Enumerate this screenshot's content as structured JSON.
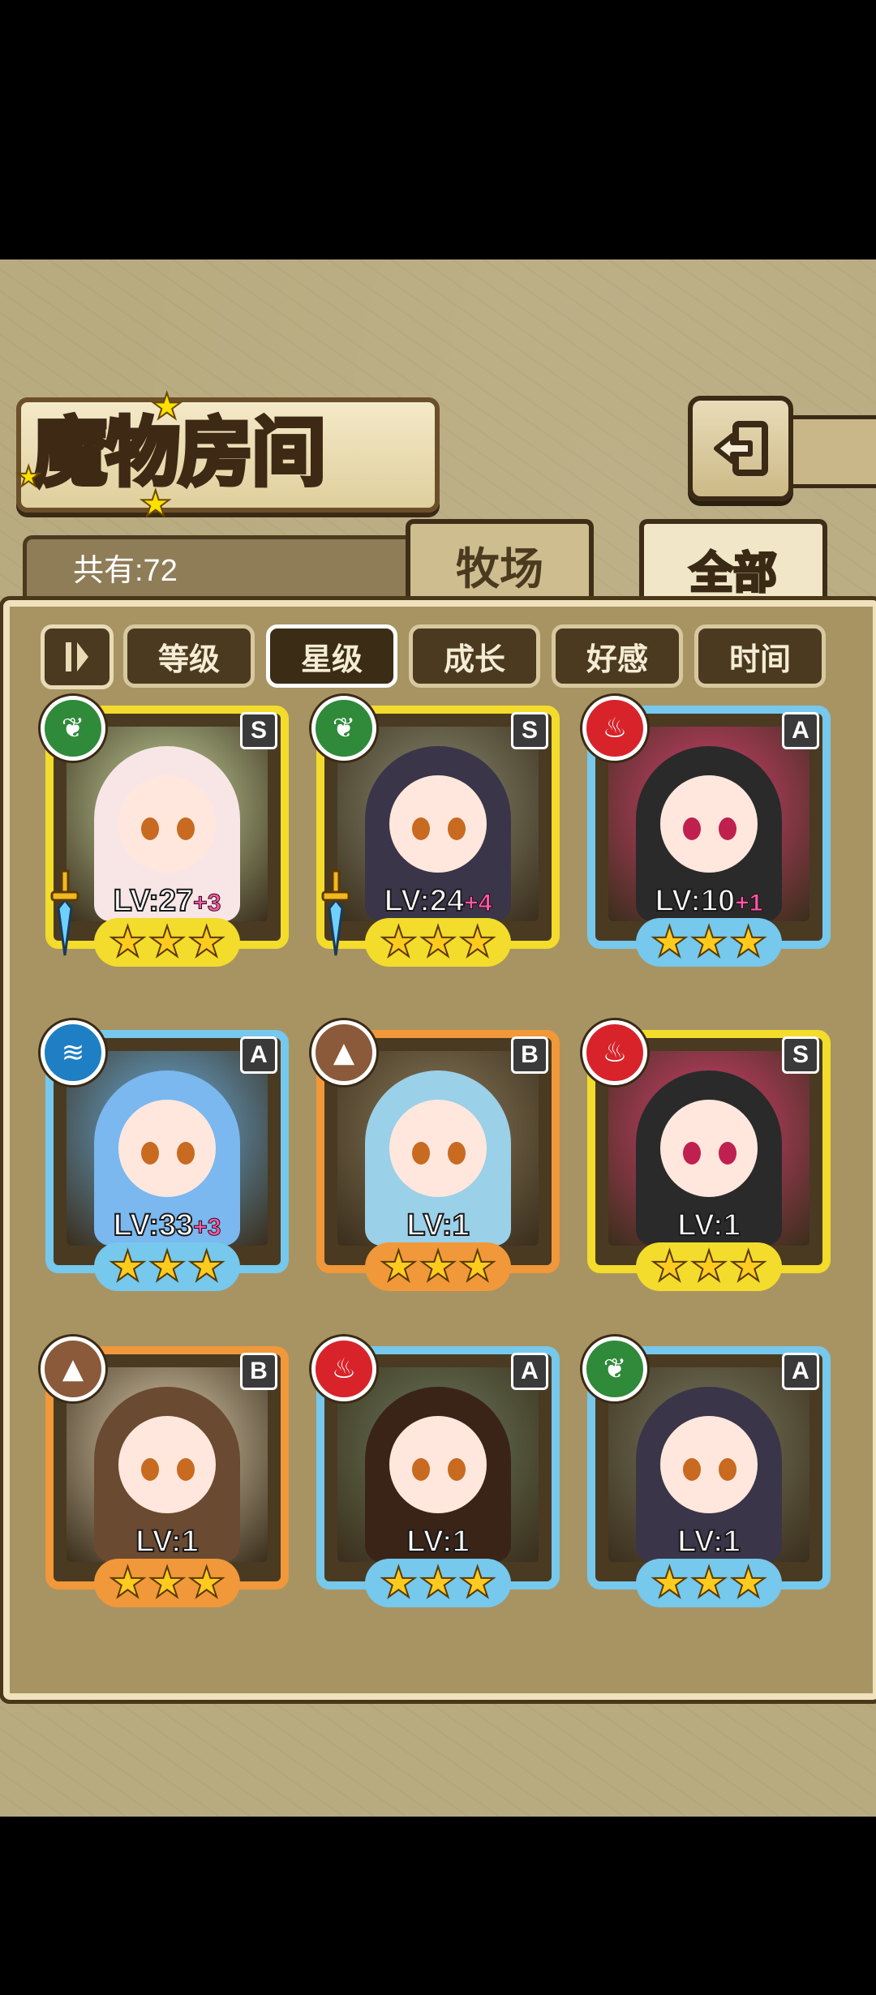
{
  "header": {
    "title": "魔物房间",
    "back_icon": "back-arrow-icon"
  },
  "summary": {
    "count_label": "共有:72"
  },
  "tabs": [
    {
      "label": "牧场",
      "active": false
    },
    {
      "label": "全部",
      "active": true
    }
  ],
  "sort": {
    "toggle_icon": "sort-order-icon",
    "options": [
      {
        "label": "等级",
        "selected": false
      },
      {
        "label": "星级",
        "selected": true
      },
      {
        "label": "成长",
        "selected": false
      },
      {
        "label": "好感",
        "selected": false
      },
      {
        "label": "时间",
        "selected": false
      }
    ]
  },
  "monsters": [
    {
      "element": "leaf-element-icon",
      "grade": "S",
      "level": "LV:27",
      "bonus": "+3",
      "stars": 3,
      "frame": "#f3dc2b",
      "equipped": true
    },
    {
      "element": "leaf-element-icon",
      "grade": "S",
      "level": "LV:24",
      "bonus": "+4",
      "stars": 3,
      "frame": "#f3dc2b",
      "equipped": true
    },
    {
      "element": "fire-element-icon",
      "grade": "A",
      "level": "LV:10",
      "bonus": "+1",
      "stars": 3,
      "frame": "#76c8ec",
      "equipped": false
    },
    {
      "element": "water-element-icon",
      "grade": "A",
      "level": "LV:33",
      "bonus": "+3",
      "stars": 3,
      "frame": "#76c8ec",
      "equipped": false
    },
    {
      "element": "earth-element-icon",
      "grade": "B",
      "level": "LV:1",
      "bonus": "",
      "stars": 3,
      "frame": "#f0983a",
      "equipped": false
    },
    {
      "element": "fire-element-icon",
      "grade": "S",
      "level": "LV:1",
      "bonus": "",
      "stars": 3,
      "frame": "#f3dc2b",
      "equipped": false
    },
    {
      "element": "earth-element-icon",
      "grade": "B",
      "level": "LV:1",
      "bonus": "",
      "stars": 3,
      "frame": "#f0983a",
      "equipped": false
    },
    {
      "element": "fire-element-icon",
      "grade": "A",
      "level": "LV:1",
      "bonus": "",
      "stars": 3,
      "frame": "#76c8ec",
      "equipped": false
    },
    {
      "element": "leaf-element-icon",
      "grade": "A",
      "level": "LV:1",
      "bonus": "",
      "stars": 3,
      "frame": "#76c8ec",
      "equipped": false
    }
  ],
  "colors": {
    "leaf": "#2f8a3a",
    "fire": "#d8232a",
    "water": "#1e7fc4",
    "earth": "#8a5a3a"
  }
}
